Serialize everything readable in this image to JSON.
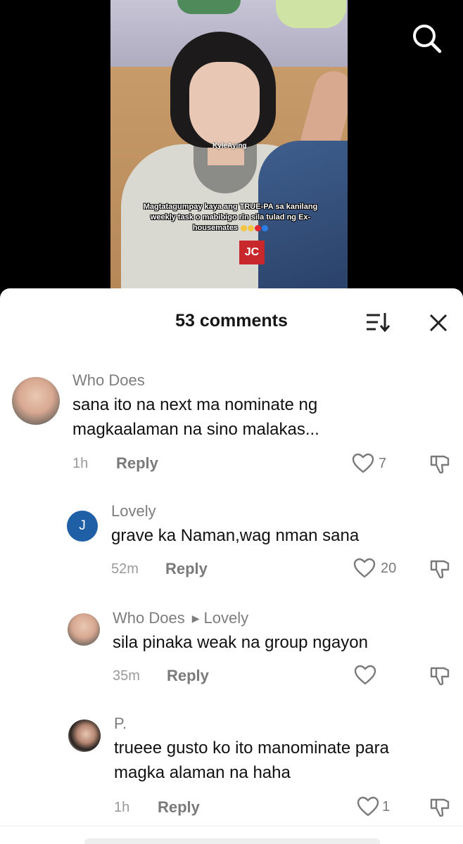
{
  "video": {
    "watermark": "KyleAying",
    "caption": "Magtatagumpay kaya ang TRUE-PA sa kanilang weekly task o mabibigo rin sila tulad ng Ex-housemates",
    "badge": "JC"
  },
  "top_bar": {
    "search_icon": "search-icon"
  },
  "comments_sheet": {
    "title": "53 comments",
    "sort_icon": "sort-icon",
    "close_icon": "close-icon",
    "comments": [
      {
        "username": "Who Does",
        "text_line1": "sana ito na next ma nominate ng",
        "text_line2": "magkaalaman na sino malakas...",
        "time": "1h",
        "reply_label": "Reply",
        "likes": "7"
      },
      {
        "avatar_letter": "J",
        "username": "Lovely",
        "text_line1": "grave ka Naman,wag nman sana",
        "time": "52m",
        "reply_label": "Reply",
        "likes": "20"
      },
      {
        "username": "Who Does",
        "reply_to": "Lovely",
        "text_line1": "sila pinaka weak na group ngayon",
        "time": "35m",
        "reply_label": "Reply",
        "likes": ""
      },
      {
        "username": "P.",
        "text_line1": "trueee gusto ko ito manominate para",
        "text_line2": "magka alaman na haha",
        "time": "1h",
        "reply_label": "Reply",
        "likes": "1"
      }
    ]
  },
  "colors": {
    "avatar_j": "#1f5fa6",
    "badge_red": "#c8272c",
    "text_primary": "#111111",
    "text_secondary": "#7d7d7d"
  }
}
